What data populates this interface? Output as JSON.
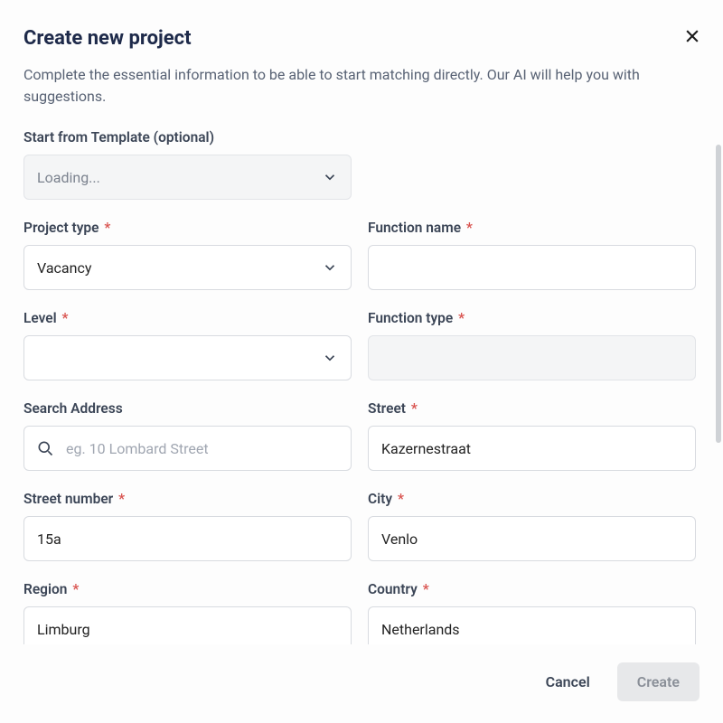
{
  "dialog": {
    "title": "Create new project",
    "subtitle": "Complete the essential information to be able to start matching directly. Our AI will help you with suggestions."
  },
  "fields": {
    "template": {
      "label": "Start from Template (optional)",
      "value": "Loading..."
    },
    "project_type": {
      "label": "Project type",
      "value": "Vacancy"
    },
    "function_name": {
      "label": "Function name",
      "value": ""
    },
    "level": {
      "label": "Level",
      "value": ""
    },
    "function_type": {
      "label": "Function type",
      "value": ""
    },
    "search_address": {
      "label": "Search Address",
      "placeholder": "eg. 10 Lombard Street",
      "value": ""
    },
    "street": {
      "label": "Street",
      "value": "Kazernestraat"
    },
    "street_number": {
      "label": "Street number",
      "value": "15a"
    },
    "city": {
      "label": "City",
      "value": "Venlo"
    },
    "region": {
      "label": "Region",
      "value": "Limburg"
    },
    "country": {
      "label": "Country",
      "value": "Netherlands"
    }
  },
  "required_marker": "*",
  "footer": {
    "cancel": "Cancel",
    "create": "Create"
  }
}
